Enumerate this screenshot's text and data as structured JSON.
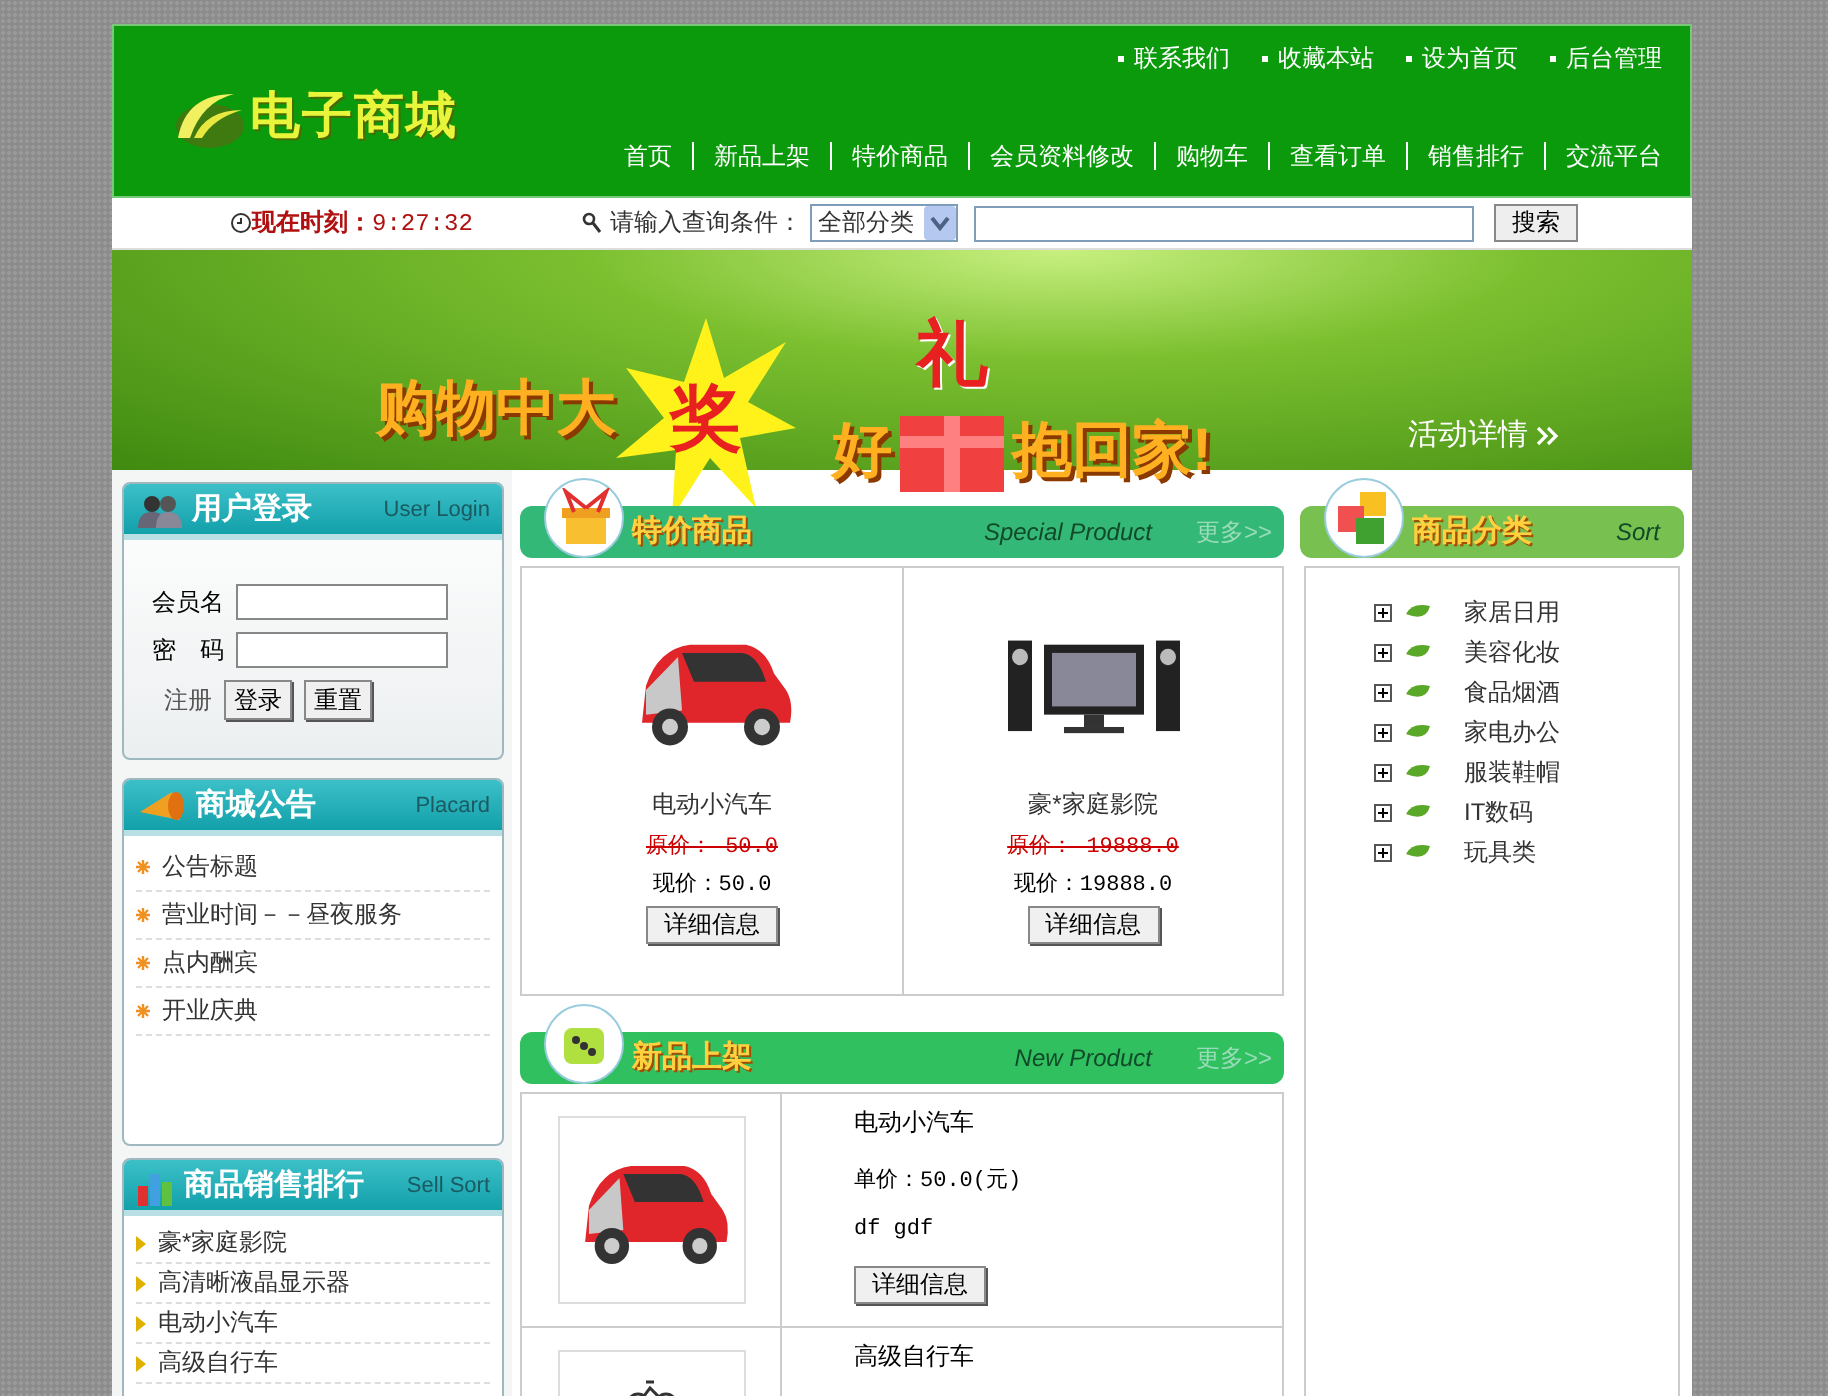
{
  "header": {
    "logo": "电子商城",
    "top_links": [
      "联系我们",
      "收藏本站",
      "设为首页",
      "后台管理"
    ],
    "nav": [
      "首页",
      "新品上架",
      "特价商品",
      "会员资料修改",
      "购物车",
      "查看订单",
      "销售排行",
      "交流平台"
    ]
  },
  "search_bar": {
    "clock_label": "现在时刻：",
    "clock_time": "9:27:32",
    "prompt": "请输入查询条件：",
    "category": "全部分类",
    "button": "搜索"
  },
  "banner": {
    "line_1": "购物中大",
    "burst": "奖",
    "line_2_start": "好",
    "gift": "礼",
    "line_2_end": "抱回家!",
    "link": "活动详情"
  },
  "login": {
    "title": "用户登录",
    "subtitle": "User Login",
    "username_label": "会员名",
    "password_label": "密　码",
    "register": "注册",
    "buttons": [
      "登录",
      "重置"
    ]
  },
  "placard": {
    "title": "商城公告",
    "subtitle": "Placard",
    "items": [
      "公告标题",
      "营业时间－－昼夜服务",
      "点内酬宾",
      "开业庆典"
    ]
  },
  "sales_rank": {
    "title": "商品销售排行",
    "subtitle": "Sell Sort",
    "items": [
      "豪*家庭影院",
      "高清晰液晶显示器",
      "电动小汽车",
      "高级自行车"
    ]
  },
  "special": {
    "title": "特价商品",
    "subtitle": "Special Product",
    "more": "更多>>",
    "products": [
      {
        "kind": "car",
        "name": "电动小汽车",
        "original_price": "原价： 50.0",
        "price": "现价：50.0",
        "button": "详细信息"
      },
      {
        "kind": "computer",
        "name": "豪*家庭影院",
        "original_price": "原价： 19888.0",
        "price": "现价：19888.0",
        "button": "详细信息"
      }
    ]
  },
  "new_products": {
    "title": "新品上架",
    "subtitle": "New Product",
    "more": "更多>>",
    "items": [
      {
        "kind": "car",
        "name": "电动小汽车",
        "price": "单价：50.0(元)",
        "description": "df gdf",
        "button": "详细信息"
      },
      {
        "kind": "bicycle",
        "name": "高级自行车"
      }
    ]
  },
  "categories": {
    "title": "商品分类",
    "subtitle": "Sort",
    "items": [
      {
        "label": "家居日用",
        "expanded": false
      },
      {
        "label": "美容化妆",
        "expanded": false
      },
      {
        "label": "食品烟酒",
        "expanded": false
      },
      {
        "label": "家电办公",
        "expanded": false
      },
      {
        "label": "服装鞋帽",
        "expanded": false
      },
      {
        "label": "IT数码",
        "expanded": false
      },
      {
        "label": "玩具类",
        "expanded": false
      }
    ]
  }
}
